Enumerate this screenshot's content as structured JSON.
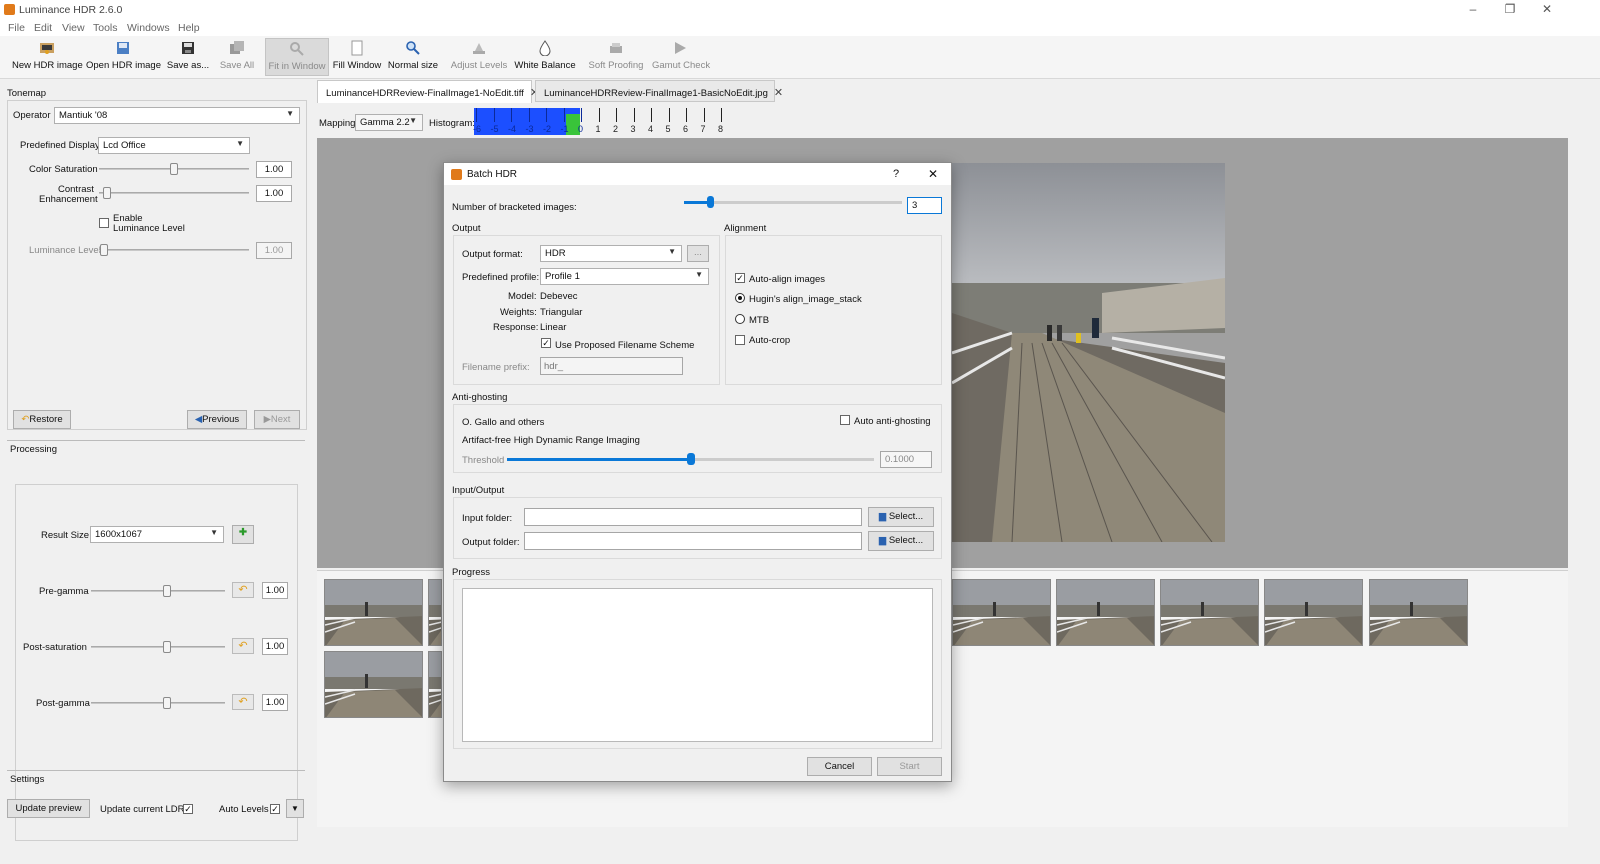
{
  "window": {
    "title": "Luminance HDR 2.6.0",
    "minimize": "–",
    "restore": "❐",
    "close": "✕"
  },
  "menu": [
    "File",
    "Edit",
    "View",
    "Tools",
    "Windows",
    "Help"
  ],
  "toolbar": [
    {
      "label": "New HDR image",
      "icon": "new-hdr-icon",
      "state": "enabled"
    },
    {
      "label": "Open HDR image",
      "icon": "open-hdr-icon",
      "state": "enabled"
    },
    {
      "label": "Save as...",
      "icon": "save-icon",
      "state": "enabled"
    },
    {
      "label": "Save All",
      "icon": "save-all-icon",
      "state": "disabled"
    },
    {
      "label": "Fit in Window",
      "icon": "fit-window-icon",
      "state": "active"
    },
    {
      "label": "Fill Window",
      "icon": "fill-window-icon",
      "state": "enabled"
    },
    {
      "label": "Normal size",
      "icon": "zoom-icon",
      "state": "enabled"
    },
    {
      "label": "Adjust Levels",
      "icon": "levels-icon",
      "state": "disabled"
    },
    {
      "label": "White Balance",
      "icon": "white-balance-icon",
      "state": "enabled"
    },
    {
      "label": "Soft Proofing",
      "icon": "soft-proofing-icon",
      "state": "disabled"
    },
    {
      "label": "Gamut Check",
      "icon": "gamut-check-icon",
      "state": "disabled"
    }
  ],
  "tonemap": {
    "section": "Tonemap",
    "operator_label": "Operator",
    "operator_value": "Mantiuk '08",
    "predefined_display_label": "Predefined Display",
    "predefined_display_value": "Lcd Office",
    "color_saturation_label": "Color Saturation",
    "color_saturation_value": "1.00",
    "color_saturation_level": 0.5,
    "contrast_label_1": "Contrast",
    "contrast_label_2": "Enhancement",
    "contrast_value": "1.00",
    "contrast_level": 0.05,
    "enable_label_1": "Enable",
    "enable_label_2": "Luminance Level",
    "luminance_label": "Luminance Level",
    "luminance_value": "1.00",
    "restore": "Restore",
    "previous": "Previous",
    "next": "Next"
  },
  "processing": {
    "section": "Processing",
    "result_size_label": "Result Size",
    "result_size_value": "1600x1067",
    "pregamma_label": "Pre-gamma",
    "pregamma_value": "1.00",
    "postsat_label": "Post-saturation",
    "postsat_value": "1.00",
    "postgamma_label": "Post-gamma",
    "postgamma_value": "1.00"
  },
  "settings": {
    "section": "Settings",
    "update_preview": "Update preview",
    "update_current_ldr": "Update current LDR",
    "auto_levels": "Auto Levels"
  },
  "tabs": [
    {
      "label": "LuminanceHDRReview-FinalImage1-NoEdit.tiff",
      "active": true
    },
    {
      "label": "LuminanceHDRReview-FinalImage1-BasicNoEdit.jpg",
      "active": false
    }
  ],
  "viewbar": {
    "mapping_label": "Mapping:",
    "mapping_value": "Gamma 2.2",
    "histogram_label": "Histogram:",
    "histogram_ticks": [
      "-6",
      "-5",
      "-4",
      "-3",
      "-2",
      "-1",
      "0",
      "1",
      "2",
      "3",
      "4",
      "5",
      "6",
      "7",
      "8"
    ]
  },
  "dialog": {
    "title": "Batch HDR",
    "help": "?",
    "close": "✕",
    "bracketed_label": "Number of bracketed images:",
    "bracketed_value": "3",
    "output_section": "Output",
    "output_format_label": "Output format:",
    "output_format_value": "HDR",
    "browse": "...",
    "profile_label": "Predefined profile:",
    "profile_value": "Profile 1",
    "model_label": "Model:",
    "model_value": "Debevec",
    "weights_label": "Weights:",
    "weights_value": "Triangular",
    "response_label": "Response:",
    "response_value": "Linear",
    "use_proposed": "Use Proposed Filename Scheme",
    "prefix_label": "Filename prefix:",
    "prefix_placeholder": "hdr_",
    "alignment_section": "Alignment",
    "auto_align": "Auto-align images",
    "hugin": "Hugin's align_image_stack",
    "mtb": "MTB",
    "auto_crop": "Auto-crop",
    "antighost_section": "Anti-ghosting",
    "gallo": "O. Gallo and others",
    "auto_antighost": "Auto anti-ghosting",
    "artifact_free": "Artifact-free High Dynamic Range Imaging",
    "threshold_label": "Threshold",
    "threshold_value": "0.1000",
    "threshold_level": 0.5,
    "io_section": "Input/Output",
    "input_folder": "Input folder:",
    "output_folder": "Output folder:",
    "select": "Select...",
    "progress_section": "Progress",
    "cancel": "Cancel",
    "start": "Start"
  },
  "colors": {
    "accent": "#0a78d7",
    "histogram_blue": "#1c4fff",
    "histogram_green": "#39c43a"
  }
}
